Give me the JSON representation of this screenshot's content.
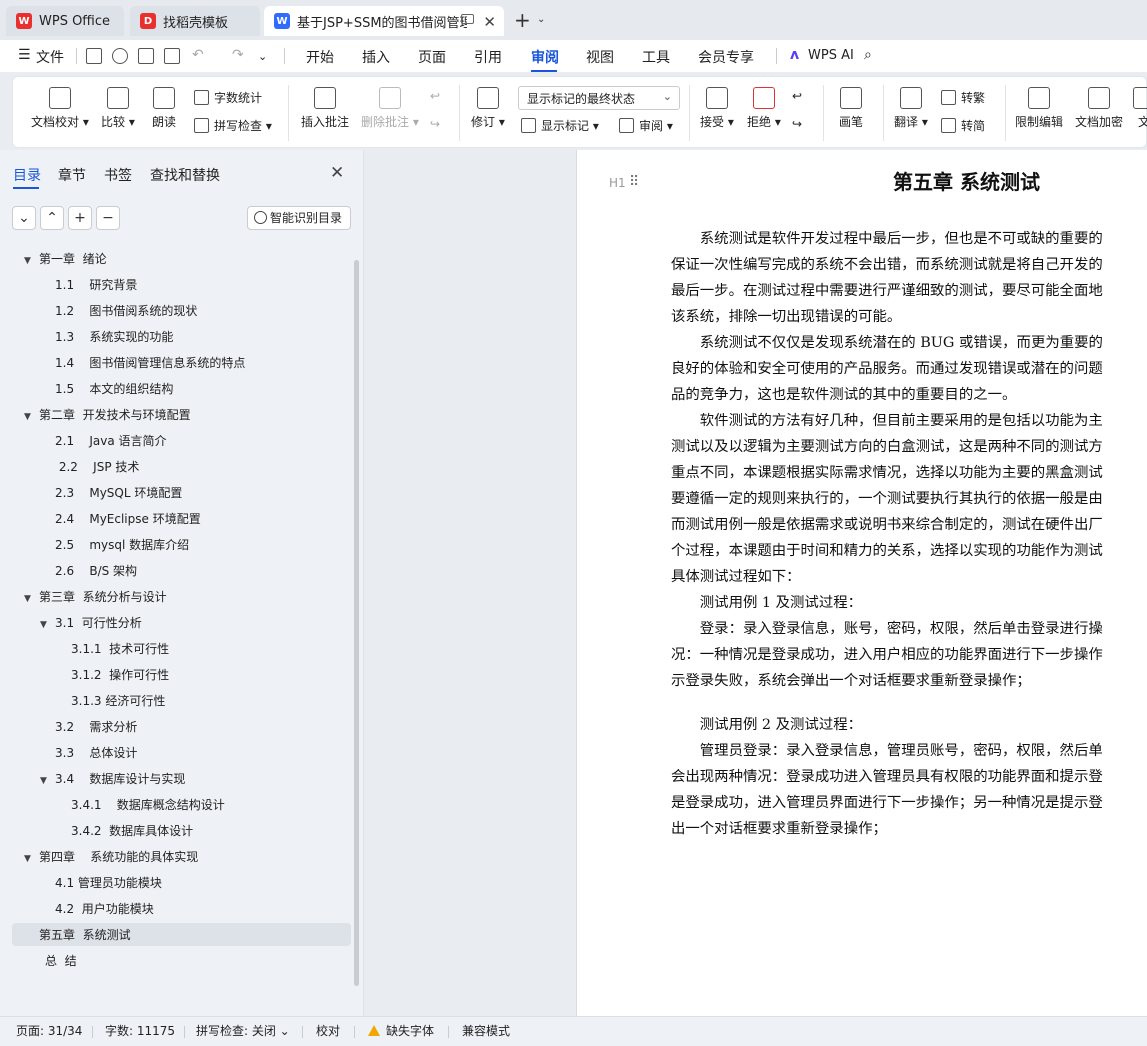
{
  "tabs": [
    {
      "label": "WPS Office",
      "icon": "wps-logo-icon",
      "color": "#e8312f"
    },
    {
      "label": "找稻壳模板",
      "icon": "docer-icon",
      "color": "#e8312f"
    },
    {
      "label": "基于JSP+SSM的图书借阅管理",
      "icon": "word-doc-icon",
      "color": "#2f6bff"
    }
  ],
  "menu": {
    "file": "文件",
    "items": [
      "开始",
      "插入",
      "页面",
      "引用",
      "审阅",
      "视图",
      "工具",
      "会员专享"
    ],
    "active": "审阅",
    "wps_ai": "WPS AI"
  },
  "ribbon": {
    "doc_check": "文档校对",
    "compare": "比较",
    "read_aloud": "朗读",
    "word_count": "字数统计",
    "spell_check": "拼写检查",
    "insert_comment": "插入批注",
    "delete_comment": "删除批注",
    "track": "修订",
    "display_state": "显示标记的最终状态",
    "show_markup": "显示标记",
    "review": "审阅",
    "accept": "接受",
    "reject": "拒绝",
    "pen": "画笔",
    "translate": "翻译",
    "to_traditional": "转繁",
    "to_simplified": "转简",
    "restrict_edit": "限制编辑",
    "doc_encrypt": "文档加密",
    "doc_cut": "文"
  },
  "side_panel": {
    "tabs": [
      "目录",
      "章节",
      "书签",
      "查找和替换"
    ],
    "smart_toc": "智能识别目录",
    "toc": [
      {
        "label": "第一章  绪论",
        "level": 1,
        "arrow": true
      },
      {
        "label": "1.1    研究背景",
        "level": 2
      },
      {
        "label": "1.2    图书借阅系统的现状",
        "level": 2
      },
      {
        "label": "1.3    系统实现的功能",
        "level": 2
      },
      {
        "label": "1.4    图书借阅管理信息系统的特点",
        "level": 2
      },
      {
        "label": "1.5    本文的组织结构",
        "level": 2
      },
      {
        "label": "第二章  开发技术与环境配置",
        "level": 1,
        "arrow": true
      },
      {
        "label": "2.1    Java 语言简介",
        "level": 2
      },
      {
        "label": " 2.2    JSP 技术",
        "level": 2
      },
      {
        "label": "2.3    MySQL 环境配置",
        "level": 2
      },
      {
        "label": "2.4    MyEclipse 环境配置",
        "level": 2
      },
      {
        "label": "2.5    mysql 数据库介绍",
        "level": 2
      },
      {
        "label": "2.6    B/S 架构",
        "level": 2
      },
      {
        "label": "第三章  系统分析与设计",
        "level": 1,
        "arrow": true
      },
      {
        "label": "3.1  可行性分析",
        "level": 2,
        "arrow": true
      },
      {
        "label": "3.1.1  技术可行性",
        "level": 3
      },
      {
        "label": "3.1.2  操作可行性",
        "level": 3
      },
      {
        "label": "3.1.3 经济可行性",
        "level": 3
      },
      {
        "label": "3.2    需求分析",
        "level": 2
      },
      {
        "label": "3.3    总体设计",
        "level": 2
      },
      {
        "label": "3.4    数据库设计与实现",
        "level": 2,
        "arrow": true
      },
      {
        "label": "3.4.1    数据库概念结构设计",
        "level": 3
      },
      {
        "label": "3.4.2  数据库具体设计",
        "level": 3
      },
      {
        "label": "第四章    系统功能的具体实现",
        "level": 1,
        "arrow": true
      },
      {
        "label": "4.1 管理员功能模块",
        "level": 2
      },
      {
        "label": "4.2  用户功能模块",
        "level": 2
      },
      {
        "label": "第五章  系统测试",
        "level": 1,
        "selected": true
      },
      {
        "label": "总  结",
        "level": 1,
        "indent_extra": true
      }
    ]
  },
  "document": {
    "heading_marker": "H1",
    "title": "第五章  系统测试",
    "lines": [
      "　　系统测试是软件开发过程中最后一步，但也是不可或缺的重要的",
      "保证一次性编写完成的系统不会出错，而系统测试就是将自己开发的",
      "最后一步。在测试过程中需要进行严谨细致的测试，要尽可能全面地",
      "该系统，排除一切出现错误的可能。",
      "　　系统测试不仅仅是发现系统潜在的 BUG 或错误，而更为重要的",
      "良好的体验和安全可使用的产品服务。而通过发现错误或潜在的问题",
      "品的竞争力，这也是软件测试的其中的重要目的之一。",
      "　　软件测试的方法有好几种，但目前主要采用的是包括以功能为主",
      "测试以及以逻辑为主要测试方向的白盒测试，这是两种不同的测试方",
      "重点不同，本课题根据实际需求情况，选择以功能为主要的黑盒测试",
      "要遵循一定的规则来执行的，一个测试要执行其执行的依据一般是由",
      "而测试用例一般是依据需求或说明书来综合制定的，测试在硬件出厂",
      "个过程，本课题由于时间和精力的关系，选择以实现的功能作为测试",
      "具体测试过程如下：",
      "　　测试用例 1 及测试过程：",
      "　　登录：录入登录信息，账号，密码，权限，然后单击登录进行操",
      "况：一种情况是登录成功，进入用户相应的功能界面进行下一步操作",
      "示登录失败，系统会弹出一个对话框要求重新登录操作；",
      "",
      "　　测试用例 2 及测试过程：",
      "　　管理员登录：录入登录信息，管理员账号，密码，权限，然后单",
      "会出现两种情况：登录成功进入管理员具有权限的功能界面和提示登",
      "是登录成功，进入管理员界面进行下一步操作；另一种情况是提示登",
      "出一个对话框要求重新登录操作；"
    ]
  },
  "status": {
    "page": "页面: 31/34",
    "words": "字数: 11175",
    "spell": "拼写检查: 关闭",
    "proof": "校对",
    "missing_font": "缺失字体",
    "compat": "兼容模式"
  }
}
